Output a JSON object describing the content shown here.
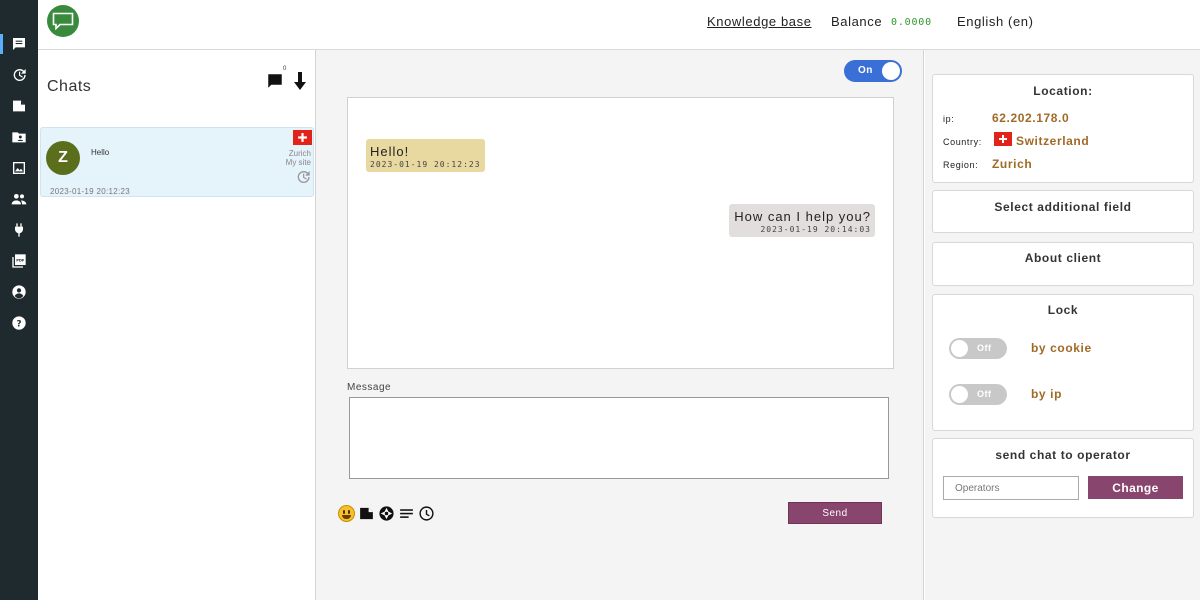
{
  "rail": {
    "icons": [
      "chat-icon",
      "history-icon",
      "file-icon",
      "folder-user-icon",
      "image-icon",
      "users-icon",
      "plug-icon",
      "pdf-icon",
      "account-circle-icon",
      "help-icon"
    ]
  },
  "header": {
    "knowledge_base": "Knowledge base",
    "balance_label": "Balance",
    "balance_value": "0.0000",
    "language": "English (en)",
    "colors": {
      "logo": "#3a8a3e",
      "balance_value": "#2f9a2f"
    }
  },
  "chats": {
    "title": "Chats",
    "unread_count": "0",
    "items": [
      {
        "avatar_letter": "Z",
        "preview": "Hello",
        "city": "Zurich",
        "site": "My site",
        "time": "2023-01-19 20:12:23",
        "flag": "switzerland-flag-icon"
      }
    ]
  },
  "main": {
    "toggle_label": "On",
    "messages": [
      {
        "direction": "in",
        "text": "Hello!",
        "time": "2023-01-19 20:12:23"
      },
      {
        "direction": "out",
        "text": "How can I help you?",
        "time": "2023-01-19 20:14:03"
      }
    ],
    "message_label": "Message",
    "message_value": "",
    "tools": [
      "emoji-icon",
      "file-icon",
      "camera-shutter-icon",
      "text-lines-icon",
      "clock-icon"
    ],
    "send_label": "Send",
    "colors": {
      "accent": "#88456d",
      "toggle_on": "#3a6fd8",
      "bubble_in": "#e8d9a0",
      "bubble_out": "#e3dede"
    }
  },
  "right": {
    "location": {
      "title": "Location:",
      "ip_label": "ip:",
      "ip_value": "62.202.178.0",
      "country_label": "Country:",
      "country_value": "Switzerland",
      "region_label": "Region:",
      "region_value": "Zurich"
    },
    "additional_field": "Select additional field",
    "about_client": "About client",
    "lock": {
      "title": "Lock",
      "toggle_label": "Off",
      "by_cookie": "by cookie",
      "by_ip": "by ip"
    },
    "send_to_operator": {
      "title": "send chat to operator",
      "placeholder": "Operators",
      "change_label": "Change"
    }
  }
}
